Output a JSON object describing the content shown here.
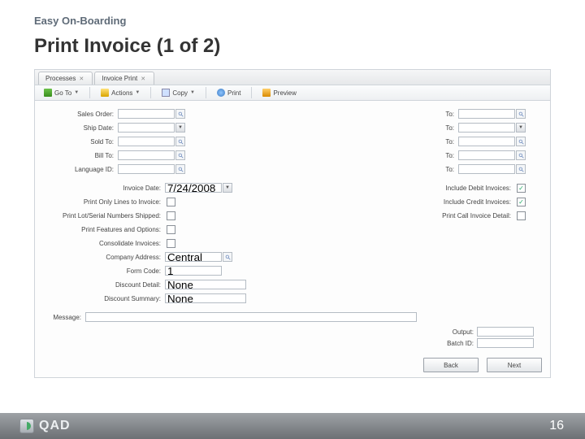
{
  "slide": {
    "subtitle": "Easy On-Boarding",
    "title": "Print Invoice (1 of 2)",
    "page_number": "16",
    "logo_text": "QAD"
  },
  "tabs": [
    {
      "label": "Processes"
    },
    {
      "label": "Invoice Print"
    }
  ],
  "toolbar": {
    "goto": "Go To",
    "actions": "Actions",
    "copy": "Copy",
    "print": "Print",
    "preview": "Preview"
  },
  "left_fields": [
    {
      "label": "Sales Order:",
      "value": ""
    },
    {
      "label": "Ship Date:",
      "value": ""
    },
    {
      "label": "Sold To:",
      "value": ""
    },
    {
      "label": "Bill To:",
      "value": ""
    },
    {
      "label": "Language ID:",
      "value": ""
    }
  ],
  "right_fields": [
    {
      "label": "To:",
      "value": ""
    },
    {
      "label": "To:",
      "value": ""
    },
    {
      "label": "To:",
      "value": ""
    },
    {
      "label": "To:",
      "value": ""
    },
    {
      "label": "To:",
      "value": ""
    }
  ],
  "mid_left": {
    "invoice_date_label": "Invoice Date:",
    "invoice_date_value": "7/24/2008",
    "chk1": "Print Only Lines to Invoice:",
    "chk2": "Print Lot/Serial Numbers Shipped:",
    "chk3": "Print Features and Options:",
    "chk4": "Consolidate Invoices:",
    "company_addr_label": "Company Address:",
    "company_addr_value": "Central",
    "form_code_label": "Form Code:",
    "form_code_value": "1",
    "discount_detail_label": "Discount Detail:",
    "discount_detail_value": "None",
    "discount_summary_label": "Discount Summary:",
    "discount_summary_value": "None"
  },
  "mid_right": {
    "r1_label": "Include Debit Invoices:",
    "r2_label": "Include Credit Invoices:",
    "r3_label": "Print Call Invoice Detail:"
  },
  "message_label": "Message:",
  "output_label": "Output:",
  "batch_label": "Batch ID:",
  "buttons": {
    "back": "Back",
    "next": "Next"
  }
}
